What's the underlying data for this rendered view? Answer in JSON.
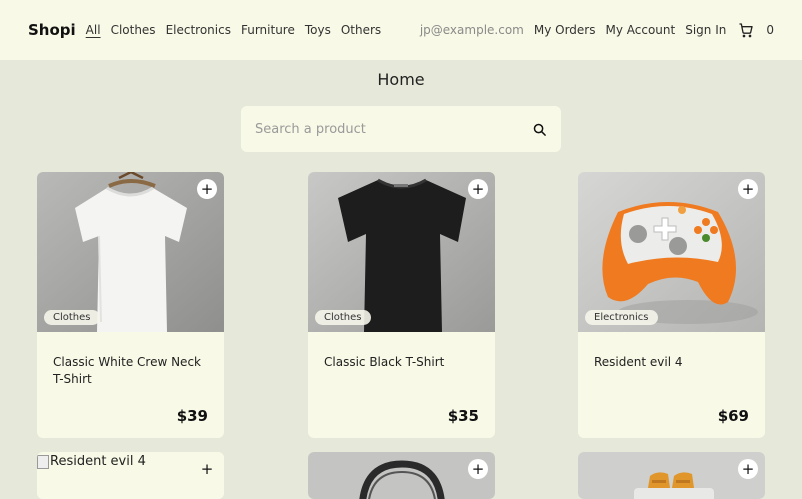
{
  "nav": {
    "brand": "Shopi",
    "categories": [
      "All",
      "Clothes",
      "Electronics",
      "Furniture",
      "Toys",
      "Others"
    ],
    "email": "jp@example.com",
    "links": [
      "My Orders",
      "My Account",
      "Sign In"
    ],
    "cart_count": "0"
  },
  "page": {
    "title": "Home"
  },
  "search": {
    "placeholder": "Search a product"
  },
  "products": [
    {
      "name": "Classic White Crew Neck T-Shirt",
      "category": "Clothes",
      "price": "$39",
      "image": "white-tshirt"
    },
    {
      "name": "Classic Black T-Shirt",
      "category": "Clothes",
      "price": "$35",
      "image": "black-tshirt"
    },
    {
      "name": "Resident evil 4",
      "category": "Electronics",
      "price": "$69",
      "image": "game-controller"
    },
    {
      "alt": "Resident evil 4",
      "image": "broken"
    },
    {
      "image": "headphones"
    },
    {
      "image": "toaster"
    }
  ],
  "colors": {
    "nav_bg": "#f8f9e6",
    "page_bg": "#e6e8d9",
    "accent_orange": "#f07a1f"
  }
}
